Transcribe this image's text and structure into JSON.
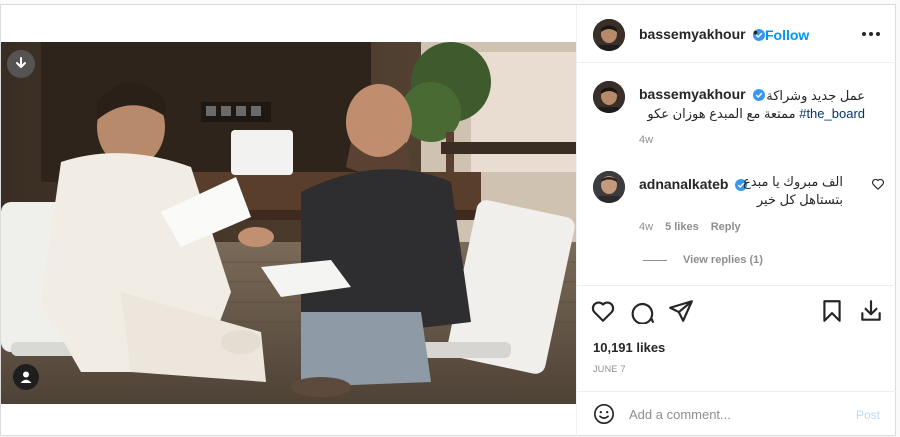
{
  "post": {
    "author": "bassemyakhour",
    "follow_label": "Follow",
    "dot": "•",
    "caption_line1": "عمل جديد وشراكة",
    "caption_line2_text": "ممتعة مع المبدع هوزان عكو",
    "caption_hashtag": "#the_board",
    "caption_time": "4w",
    "likes": "10,191 likes",
    "date": "JUNE 7"
  },
  "comment": {
    "author": "adnanalkateb",
    "line1": "الف مبروك يا مبدع",
    "line2": "بتستاهل كل خير",
    "time": "4w",
    "likes": "5 likes",
    "reply_label": "Reply",
    "view_replies": "View replies (1)"
  },
  "composer": {
    "placeholder": "Add a comment...",
    "post_label": "Post"
  },
  "colors": {
    "accent": "#0095f6",
    "verified": "#3897f0",
    "hashtag": "#00376b",
    "muted": "#8e8e8e"
  },
  "icons": [
    "download-icon",
    "user-tag-icon",
    "more-icon",
    "heart-icon",
    "comment-icon",
    "share-icon",
    "bookmark-icon",
    "save-download-icon",
    "emoji-icon",
    "verified-icon"
  ]
}
